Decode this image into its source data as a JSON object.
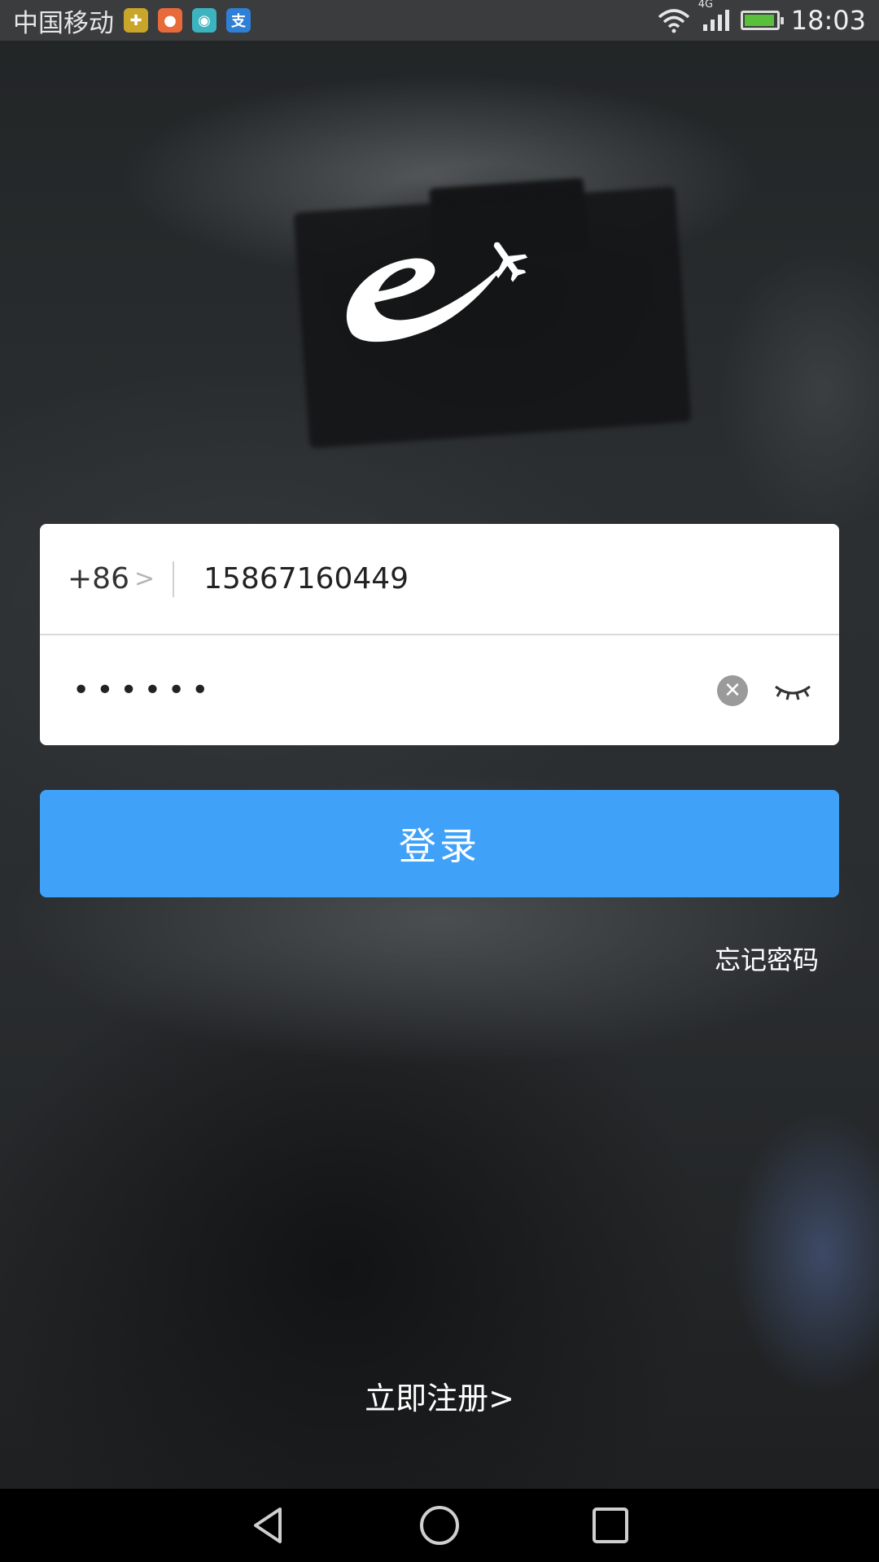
{
  "status_bar": {
    "carrier": "中国移动",
    "network": "4G",
    "time": "18:03",
    "battery_level": 0.95,
    "notification_icons": [
      "app-icon-1",
      "app-icon-2",
      "android-icon",
      "alipay-icon"
    ]
  },
  "logo": {
    "icon": "e-airplane-logo"
  },
  "login_form": {
    "country_code": "+86",
    "phone_value": "15867160449",
    "password_masked": "••••••"
  },
  "buttons": {
    "login_label": "登录",
    "forgot_password": "忘记密码",
    "register": "立即注册"
  },
  "colors": {
    "primary": "#40a1f9",
    "card": "#ffffff",
    "text_dark": "#222222"
  }
}
